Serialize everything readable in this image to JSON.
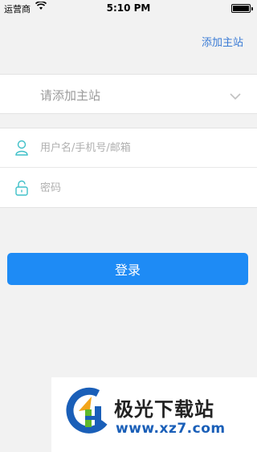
{
  "status_bar": {
    "carrier": "运营商",
    "time": "5:10 PM",
    "battery_level": 1.0
  },
  "header": {
    "add_site_label": "添加主站"
  },
  "site_select": {
    "placeholder": "请添加主站",
    "icon": "chevron-down-icon"
  },
  "login_form": {
    "username_placeholder": "用户名/手机号/邮箱",
    "username_icon": "user-icon",
    "password_placeholder": "密码",
    "password_icon": "lock-icon",
    "submit_label": "登录"
  },
  "watermark": {
    "title": "极光下载站",
    "url": "www.xz7.com"
  },
  "colors": {
    "accent": "#1e8bf5",
    "link": "#3a7bd5",
    "icon_teal": "#3fc0c8",
    "background": "#f2f2f2"
  }
}
